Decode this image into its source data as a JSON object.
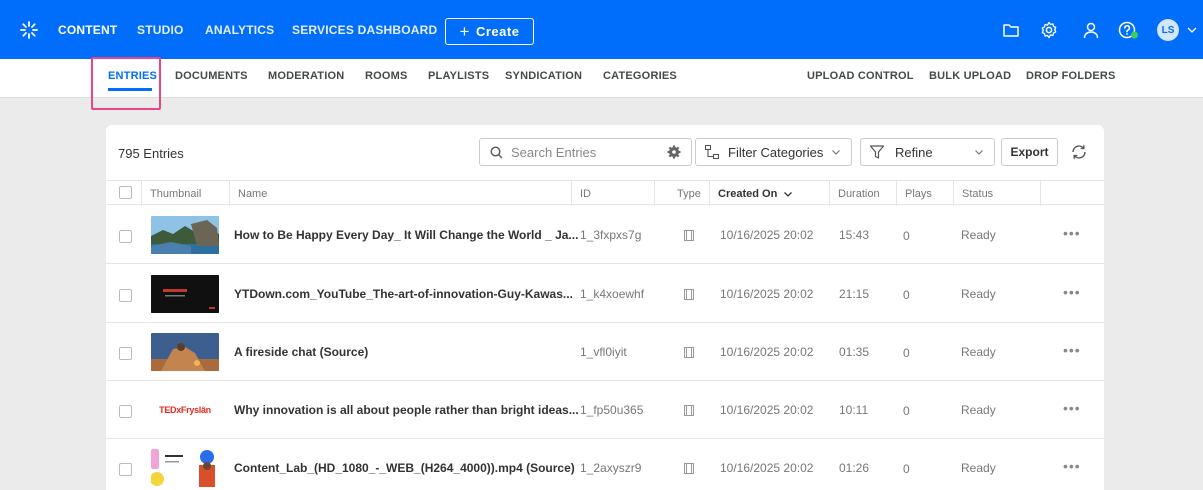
{
  "topnav": {
    "items": [
      {
        "label": "CONTENT",
        "active": true
      },
      {
        "label": "STUDIO",
        "active": false
      },
      {
        "label": "ANALYTICS",
        "active": false
      },
      {
        "label": "SERVICES DASHBOARD",
        "active": false
      }
    ],
    "create_label": "Create",
    "avatar_initials": "LS",
    "icons": [
      "folder-icon",
      "gear-icon",
      "user-icon",
      "help-icon"
    ]
  },
  "subnav": {
    "left_items": [
      "ENTRIES",
      "DOCUMENTS",
      "MODERATION",
      "ROOMS",
      "PLAYLISTS",
      "SYNDICATION",
      "CATEGORIES"
    ],
    "right_items": [
      "UPLOAD CONTROL",
      "BULK UPLOAD",
      "DROP FOLDERS"
    ],
    "active": "ENTRIES"
  },
  "toolbar": {
    "count": "795 Entries",
    "search_placeholder": "Search Entries",
    "filter_label": "Filter Categories",
    "refine_label": "Refine",
    "export_label": "Export"
  },
  "table": {
    "columns": [
      "Thumbnail",
      "Name",
      "ID",
      "Type",
      "Created On",
      "Duration",
      "Plays",
      "Status"
    ],
    "sorted_column": "Created On",
    "rows": [
      {
        "name": "How to Be Happy Every Day_ It Will Change the World _ Ja...",
        "id": "1_3fxpxs7g",
        "created": "10/16/2025 20:02",
        "duration": "15:43",
        "plays": "0",
        "status": "Ready",
        "thumb": "coast"
      },
      {
        "name": "YTDown.com_YouTube_The-art-of-innovation-Guy-Kawas...",
        "id": "1_k4xoewhf",
        "created": "10/16/2025 20:02",
        "duration": "21:15",
        "plays": "0",
        "status": "Ready",
        "thumb": "dark"
      },
      {
        "name": "A fireside chat (Source)",
        "id": "1_vfl0iyit",
        "created": "10/16/2025 20:02",
        "duration": "01:35",
        "plays": "0",
        "status": "Ready",
        "thumb": "fire"
      },
      {
        "name": "Why innovation is all about people rather than bright ideas...",
        "id": "1_fp50u365",
        "created": "10/16/2025 20:02",
        "duration": "10:11",
        "plays": "0",
        "status": "Ready",
        "thumb": "ted",
        "thumb_text": "TEDxFryslân"
      },
      {
        "name": "Content_Lab_(HD_1080_-_WEB_(H264_4000)).mp4 (Source)",
        "id": "1_2axyszr9",
        "created": "10/16/2025 20:02",
        "duration": "01:26",
        "plays": "0",
        "status": "Ready",
        "thumb": "lab",
        "thumb_text": "Content Lab"
      }
    ]
  },
  "colors": {
    "brand": "#006efa",
    "highlight": "#e8458b"
  }
}
